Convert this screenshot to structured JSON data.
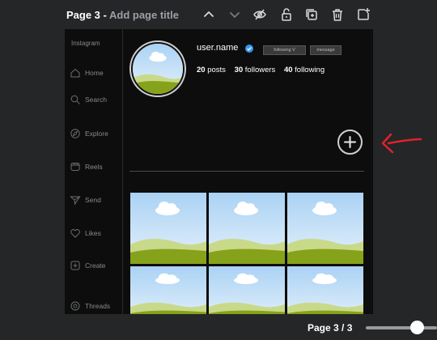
{
  "pagebar": {
    "page_label": "Page 3",
    "separator": " - ",
    "title_placeholder": "Add page title",
    "icons": [
      "chevron-up-icon",
      "chevron-down-icon",
      "eye-slash-icon",
      "unlock-icon",
      "duplicate-icon",
      "trash-icon",
      "add-page-icon"
    ]
  },
  "profile": {
    "platform": "Instagram",
    "username": "user.name",
    "follow_label": "following  V",
    "message_label": "message",
    "stats": [
      {
        "value": "20",
        "label": "posts"
      },
      {
        "value": "30",
        "label": "followers"
      },
      {
        "value": "40",
        "label": "following"
      }
    ]
  },
  "sidebar": {
    "items": [
      {
        "label": "Home",
        "icon": "home-icon"
      },
      {
        "label": "Search",
        "icon": "search-icon"
      },
      {
        "label": "Explore",
        "icon": "compass-icon"
      },
      {
        "label": "Reels",
        "icon": "reels-icon"
      },
      {
        "label": "Send",
        "icon": "send-icon"
      },
      {
        "label": "Likes",
        "icon": "heart-icon"
      },
      {
        "label": "Create",
        "icon": "plus-square-icon"
      },
      {
        "label": "Threads",
        "icon": "threads-icon"
      }
    ]
  },
  "footer": {
    "page_counter": "Page 3 / 3"
  },
  "colors": {
    "background": "#252627",
    "page": "#0d0d0d",
    "verified": "#3897f0",
    "annotation": "#e0212e"
  }
}
